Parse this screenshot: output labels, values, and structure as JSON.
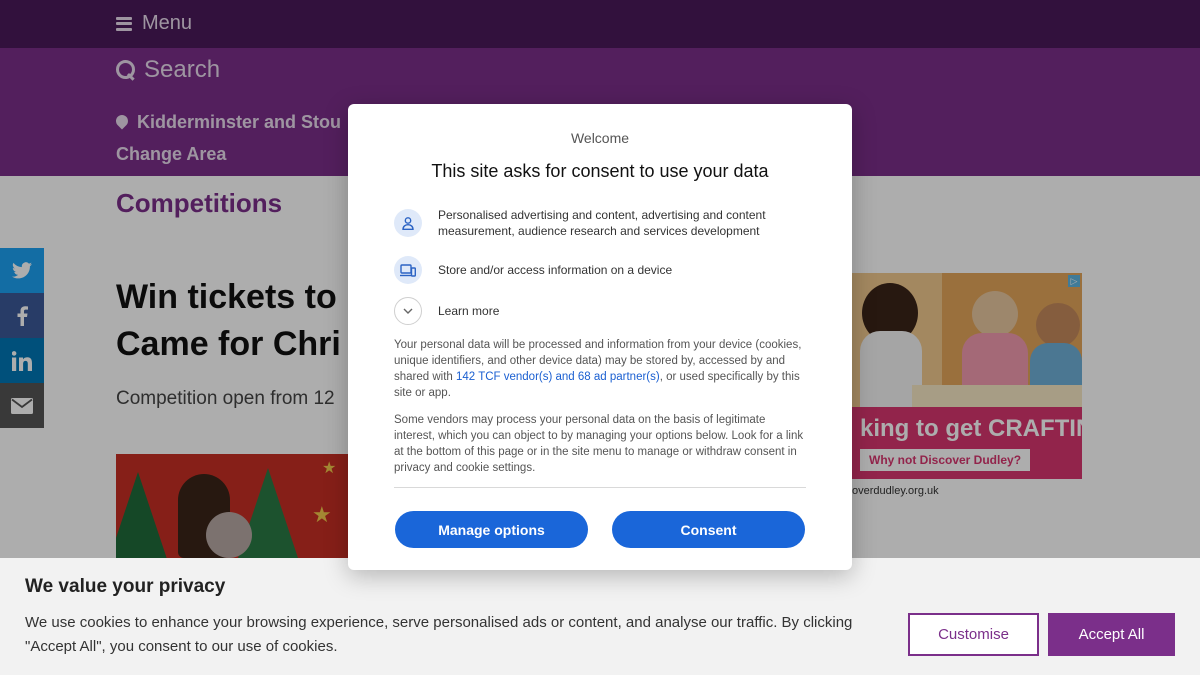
{
  "header": {
    "menu_label": "Menu",
    "search_label": "Search",
    "location": "Kidderminster and Stou",
    "change_area": "Change Area"
  },
  "page": {
    "section_title": "Competitions",
    "article_title_line1": "Win tickets to",
    "article_title_line2": "Came for Chri",
    "article_subtitle": "Competition open from 12"
  },
  "share": {
    "icons": [
      "twitter-icon",
      "facebook-icon",
      "linkedin-icon",
      "email-icon"
    ],
    "colors": [
      "#1da1f2",
      "#3b5998",
      "#0077b5",
      "#555555"
    ]
  },
  "ad": {
    "headline": "king to get CRAFTING",
    "cta": "Why not Discover Dudley?",
    "footer": "overdudley.org.uk"
  },
  "consent_modal": {
    "welcome": "Welcome",
    "heading": "This site asks for consent to use your data",
    "purposes": [
      "Personalised advertising and content, advertising and content measurement, audience research and services development",
      "Store and/or access information on a device"
    ],
    "learn_more": "Learn more",
    "paragraph1_before": "Your personal data will be processed and information from your device (cookies, unique identifiers, and other device data) may be stored by, accessed by and shared with ",
    "vendor_link": "142 TCF vendor(s) and 68 ad partner(s)",
    "paragraph1_after": ", or used specifically by this site or app.",
    "paragraph2": "Some vendors may process your personal data on the basis of legitimate interest, which you can object to by managing your options below. Look for a link at the bottom of this page or in the site menu to manage or withdraw consent in privacy and cookie settings.",
    "manage_label": "Manage options",
    "consent_label": "Consent"
  },
  "privacy_bar": {
    "title": "We value your privacy",
    "text": "We use cookies to enhance your browsing experience, serve personalised ads or content, and analyse our traffic. By clicking \"Accept All\", you consent to our use of cookies.",
    "customise_label": "Customise",
    "accept_label": "Accept All"
  },
  "colors": {
    "brand_dark": "#4a1a5a",
    "brand": "#7b2f8a",
    "consent_blue": "#1a66d9"
  }
}
